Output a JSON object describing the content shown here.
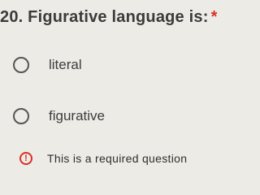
{
  "question": {
    "number_and_title": "20. Figurative language is:",
    "required_marker": "*"
  },
  "options": [
    {
      "label": "literal",
      "selected": false
    },
    {
      "label": "figurative",
      "selected": false
    }
  ],
  "validation": {
    "icon": "exclamation-circle-icon",
    "icon_glyph": "!",
    "message": "This is a required question",
    "color": "#d93025"
  }
}
